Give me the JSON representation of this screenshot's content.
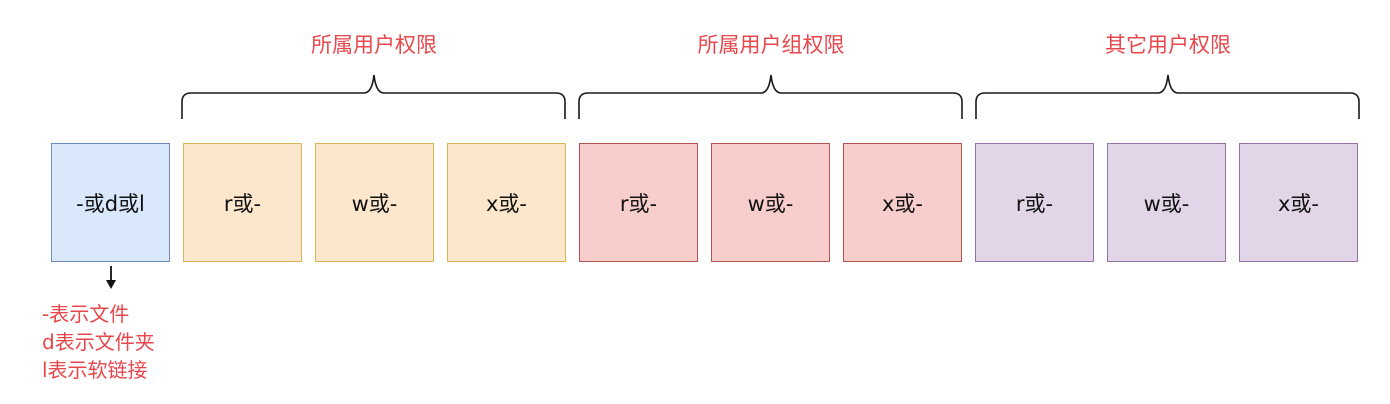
{
  "groups": [
    {
      "label": "所属用户权限"
    },
    {
      "label": "所属用户组权限"
    },
    {
      "label": "其它用户权限"
    }
  ],
  "cells": {
    "type": "-或d或l",
    "owner": [
      "r或-",
      "w或-",
      "x或-"
    ],
    "group": [
      "r或-",
      "w或-",
      "x或-"
    ],
    "other": [
      "r或-",
      "w或-",
      "x或-"
    ]
  },
  "type_note": [
    "-表示文件",
    "d表示文件夹",
    "l表示软链接"
  ],
  "colors": {
    "label_red": "#e8474c",
    "type_fill": "#dae8fc",
    "owner_fill": "#fce7cc",
    "group_fill": "#f8cecc",
    "other_fill": "#e1d5e7"
  }
}
